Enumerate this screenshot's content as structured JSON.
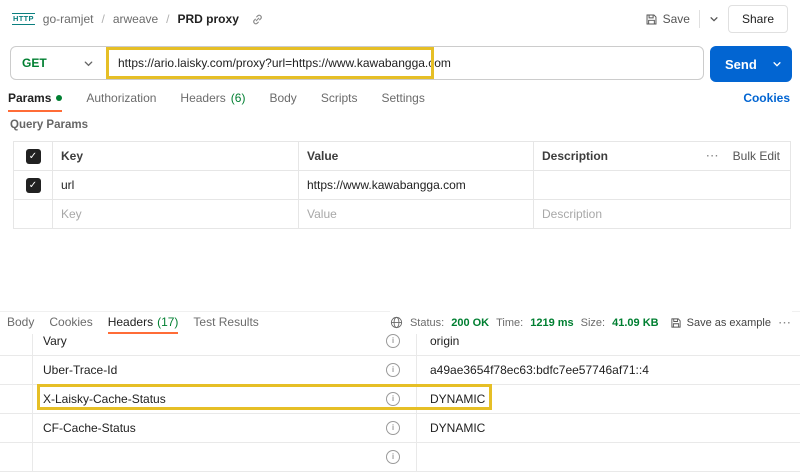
{
  "icons": {
    "check": "✓",
    "more": "⋯",
    "info": "i"
  },
  "colors": {
    "accent_orange": "#ff6c37",
    "green": "#007f31",
    "blue": "#0265d2",
    "highlight_yellow": "#e6bf26",
    "send_blue": "#0265d2"
  },
  "header": {
    "protocol_badge": "HTTP",
    "breadcrumb": {
      "workspace": "go-ramjet",
      "collection": "arweave",
      "request": "PRD proxy",
      "separator": "/"
    },
    "save_label": "Save",
    "share_label": "Share"
  },
  "request": {
    "method": "GET",
    "url": "https://ario.laisky.com/proxy?url=https://www.kawabangga.com",
    "send_label": "Send"
  },
  "request_tabs": {
    "params": {
      "label": "Params"
    },
    "authorization": {
      "label": "Authorization"
    },
    "headers": {
      "label": "Headers",
      "count": "(6)"
    },
    "body": {
      "label": "Body"
    },
    "scripts": {
      "label": "Scripts"
    },
    "settings": {
      "label": "Settings"
    },
    "cookies_link": "Cookies"
  },
  "query_params": {
    "title": "Query Params",
    "columns": {
      "key": "Key",
      "value": "Value",
      "description": "Description"
    },
    "bulk_edit": "Bulk Edit",
    "rows": [
      {
        "key": "url",
        "value": "https://www.kawabangga.com",
        "description": ""
      }
    ],
    "placeholder": {
      "key": "Key",
      "value": "Value",
      "description": "Description"
    }
  },
  "response": {
    "tabs": {
      "body": "Body",
      "cookies": "Cookies",
      "headers": "Headers",
      "headers_count": "(17)",
      "test_results": "Test Results"
    },
    "meta": {
      "status_label": "Status:",
      "status_value": "200 OK",
      "time_label": "Time:",
      "time_value": "1219 ms",
      "size_label": "Size:",
      "size_value": "41.09 KB",
      "save_example": "Save as example"
    },
    "headers": [
      {
        "key": "Vary",
        "value": "origin"
      },
      {
        "key": "Uber-Trace-Id",
        "value": "a49ae3654f78ec63:bdfc7ee57746af71::4"
      },
      {
        "key": "X-Laisky-Cache-Status",
        "value": "DYNAMIC",
        "highlighted": true
      },
      {
        "key": "CF-Cache-Status",
        "value": "DYNAMIC"
      }
    ]
  }
}
